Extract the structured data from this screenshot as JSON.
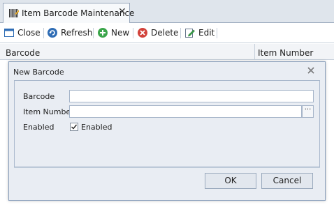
{
  "tab": {
    "title": "Item Barcode Maintenance",
    "close_glyph": "✕"
  },
  "toolbar": {
    "close_label": "Close",
    "refresh_label": "Refresh",
    "new_label": "New",
    "delete_label": "Delete",
    "edit_label": "Edit",
    "icons": [
      "close-window-icon",
      "refresh-icon",
      "plus-icon",
      "delete-icon",
      "edit-icon"
    ]
  },
  "grid": {
    "columns": [
      "Barcode",
      "Item Number"
    ]
  },
  "dialog": {
    "title": "New Barcode",
    "fields": {
      "barcode_label": "Barcode",
      "barcode_value": "",
      "item_number_label": "Item Number",
      "item_number_value": "",
      "ellipsis": "···",
      "enabled_label": "Enabled",
      "enabled_checkbox_label": "Enabled",
      "enabled_checked": true
    },
    "ok_label": "OK",
    "cancel_label": "Cancel"
  },
  "colors": {
    "accent_blue": "#2f6db5",
    "new_green": "#3aa54a",
    "delete_red": "#d2423a"
  }
}
